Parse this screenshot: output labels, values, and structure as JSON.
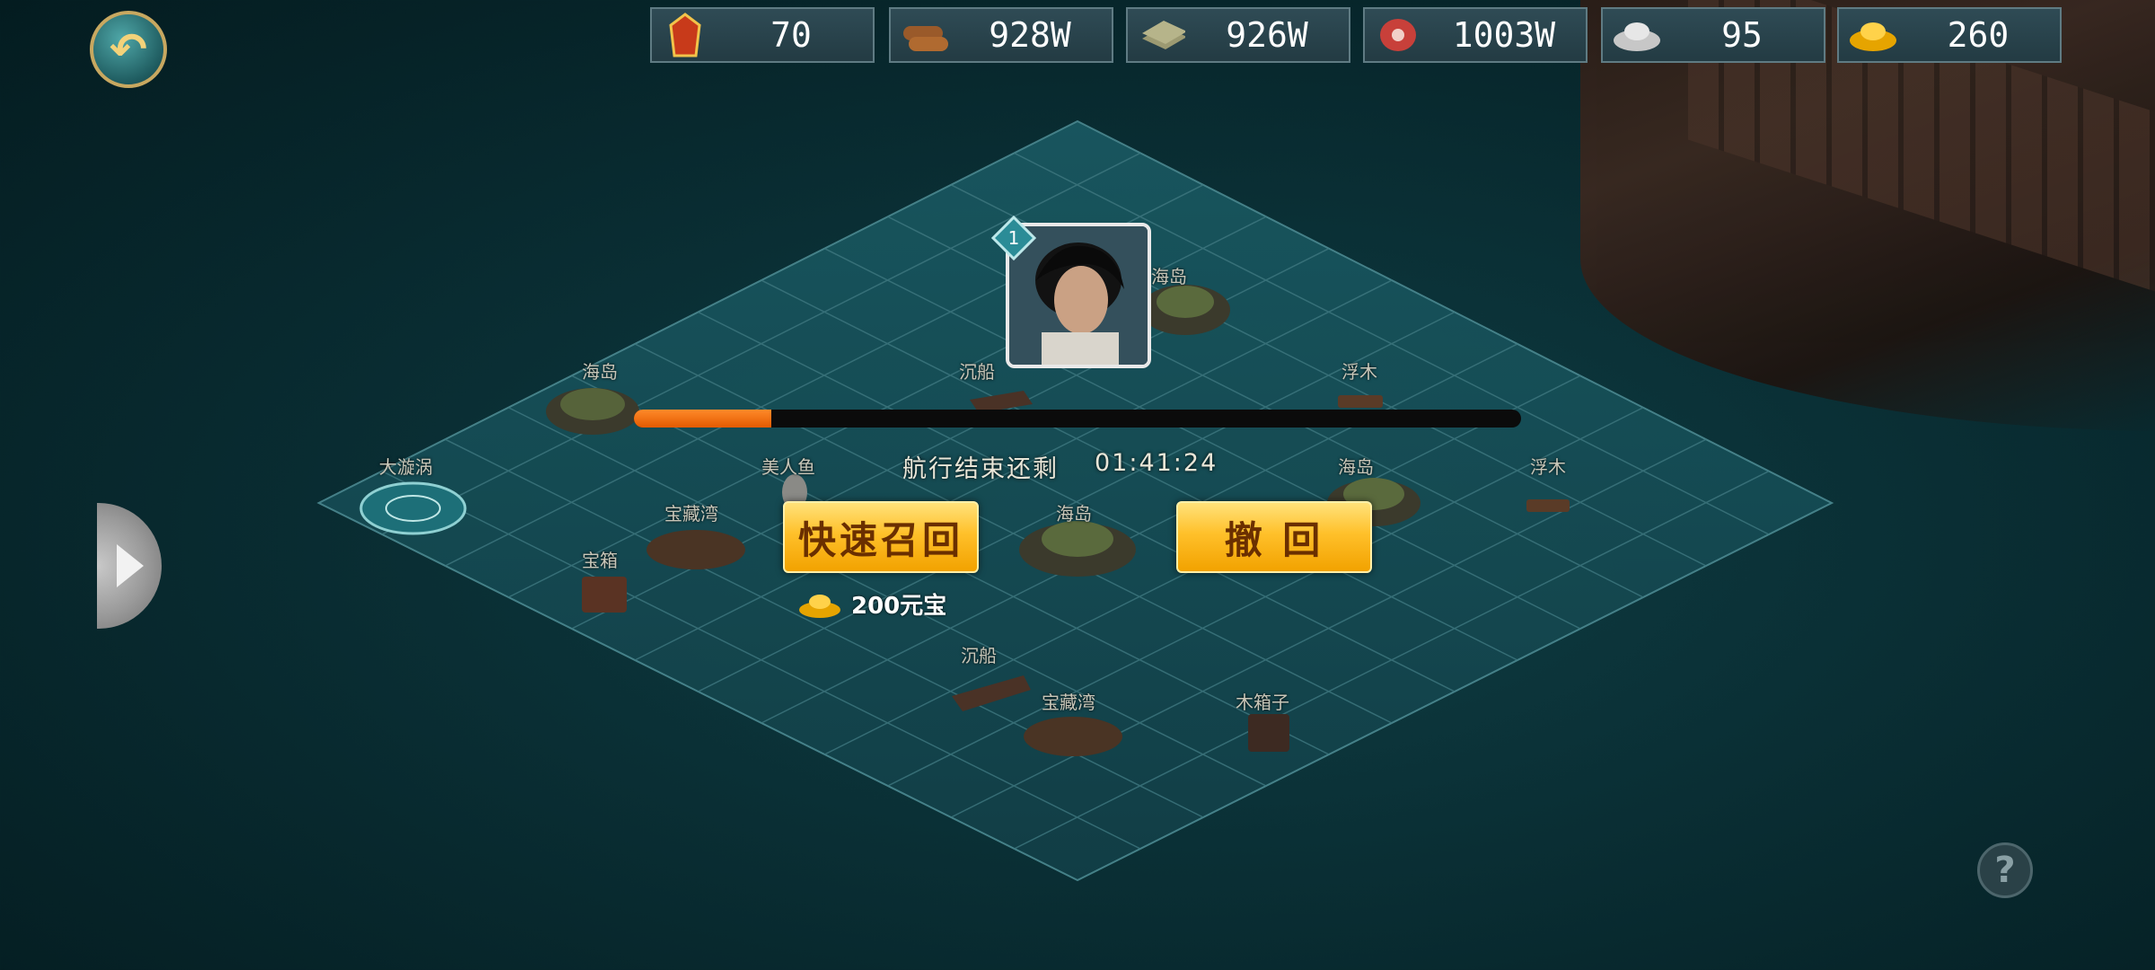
{
  "resources": [
    {
      "icon": "token-icon",
      "value": "70"
    },
    {
      "icon": "wood-icon",
      "value": "928W"
    },
    {
      "icon": "stone-icon",
      "value": "926W"
    },
    {
      "icon": "meat-icon",
      "value": "1003W"
    },
    {
      "icon": "silver-icon",
      "value": "95"
    },
    {
      "icon": "gold-ingot-icon",
      "value": "260"
    }
  ],
  "map_labels": {
    "l1": "海岛",
    "l2": "沉船",
    "l3": "浮木",
    "l4": "大漩涡",
    "l5": "美人鱼",
    "l6": "海岛",
    "l7": "浮木",
    "l8": "宝藏湾",
    "l9": "海岛",
    "l10": "宝箱",
    "l11": "沉船",
    "l12": "宝藏湾",
    "l13": "木箱子",
    "l14": "海岛"
  },
  "hero": {
    "level": "1"
  },
  "voyage": {
    "label": "航行结束还剩",
    "time": "01:41:24",
    "progress": 0.155
  },
  "buttons": {
    "quick_recall": "快速召回",
    "recall": "撤 回"
  },
  "cost": {
    "text": "200元宝"
  },
  "help": {
    "label": "?"
  },
  "colors": {
    "accent": "#f2a200",
    "progress": "#ff7a1a",
    "sea": "#0b3238"
  }
}
